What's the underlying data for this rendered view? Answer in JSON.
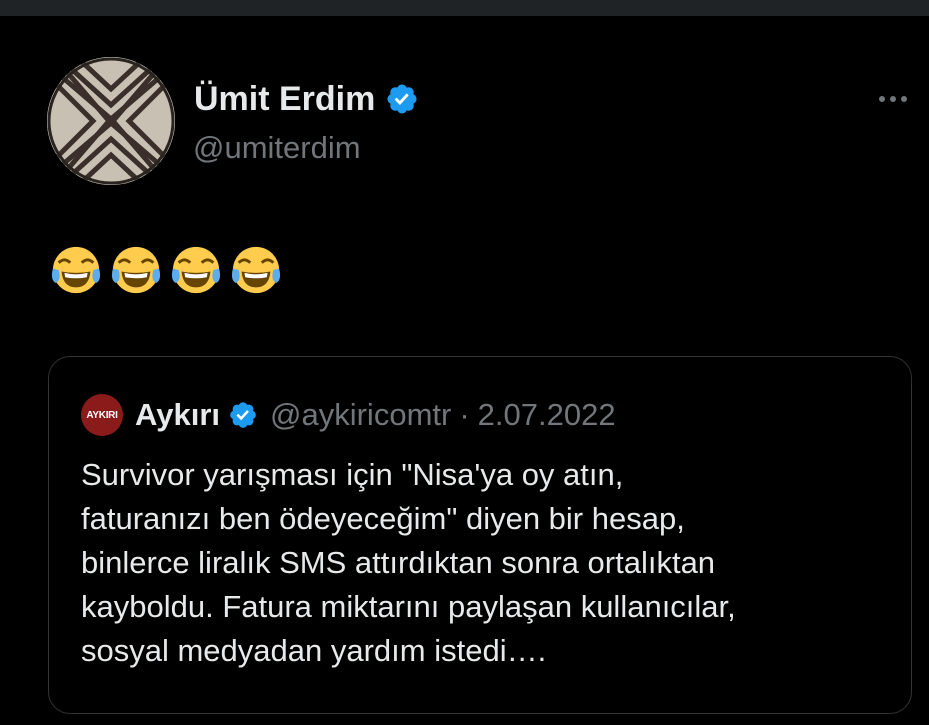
{
  "tweet": {
    "author_name": "Ümit Erdim",
    "author_handle": "@umiterdim",
    "verified_icon": "verified-badge-icon",
    "more_icon": "more-options-icon",
    "emoji_icon": "face-with-tears-of-joy-emoji",
    "emoji_count": 4
  },
  "quoted_tweet": {
    "avatar_text": "AYKIRI",
    "author_name": "Aykırı",
    "author_handle": "@aykiricomtr",
    "separator": "·",
    "date": "2.07.2022",
    "text": "Survivor yarışması için \"Nisa'ya oy atın,\nfaturanızı ben ödeyeceğim\" diyen bir hesap,\nbinlerce liralık SMS attırdıktan sonra ortalıktan\nkayboldu. Fatura miktarını paylaşan kullanıcılar,\nsosyal medyadan yardım istedi…."
  },
  "colors": {
    "background": "#000000",
    "primary_text": "#e7e9ea",
    "secondary_text": "#71767b",
    "verified_blue": "#1d9bf0",
    "border": "#2f3336",
    "aykiri_red": "#8b1a1a"
  }
}
